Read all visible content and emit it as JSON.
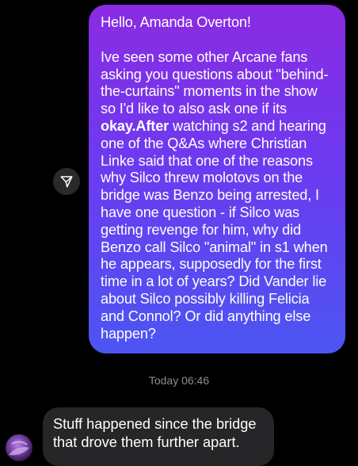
{
  "outgoing_message": {
    "greeting": "Hello, Amanda Overton!",
    "body_before_bold": "Ive seen some other Arcane fans asking you questions about \"behind-the-curtains\" moments in the show so I'd like to also ask one if its ",
    "body_bold": "okay.After",
    "body_after_bold": " watching s2 and hearing one of the Q&As where Christian  Linke said that one of the reasons why Silco threw molotovs on the bridge was Benzo being arrested, I have one question - if Silco was getting revenge for him, why did Benzo call Silco \"animal\" in s1 when he appears, supposedly for the first time in a lot of years? Did Vander lie about Silco possibly killing Felicia and Connol? Or did anything else happen?"
  },
  "timestamp": "Today 06:46",
  "incoming_message": {
    "text": "Stuff happened since the bridge that drove them further apart."
  },
  "icons": {
    "share": "paper-plane-icon",
    "avatar": "user-avatar"
  },
  "colors": {
    "bubble_gradient_top": "#8a2be2",
    "bubble_gradient_bottom": "#4c55f2",
    "incoming_bubble": "#262629",
    "background": "#000000"
  }
}
